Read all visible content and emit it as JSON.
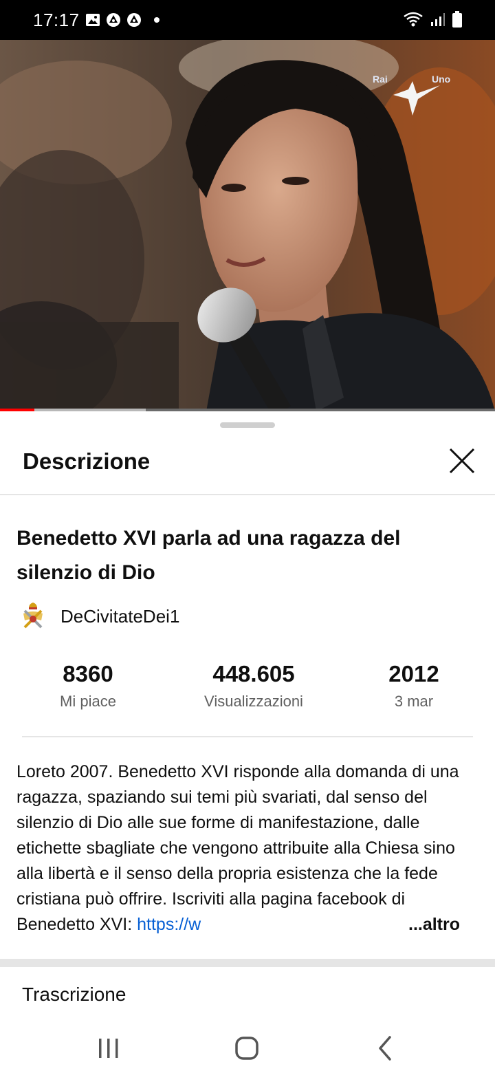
{
  "status_bar": {
    "time": "17:17",
    "icons_left": [
      "gallery-icon",
      "notification-icon",
      "notification-icon"
    ],
    "icons_right": [
      "wifi-icon",
      "signal-icon",
      "battery-icon"
    ]
  },
  "video": {
    "channel_logo_text_left": "Rai",
    "channel_logo_text_right": "Uno",
    "progress_played_fraction": 0.07,
    "progress_buffered_fraction": 0.295
  },
  "sheet": {
    "title": "Descrizione",
    "close_icon": "close-icon"
  },
  "video_info": {
    "title": "Benedetto XVI parla ad una ragazza del silenzio di Dio",
    "channel_name": "DeCivitateDei1"
  },
  "stats": {
    "likes_value": "8360",
    "likes_label": "Mi piace",
    "views_value": "448.605",
    "views_label": "Visualizzazioni",
    "year_value": "2012",
    "date_label": "3 mar"
  },
  "description": {
    "text": "Loreto 2007. Benedetto XVI risponde alla domanda di una ragazza, spaziando sui temi più svariati, dal senso del silenzio di Dio alle sue forme di manifestazione, dalle etichette sbagliate che vengono attribuite alla Chiesa sino alla libertà e il senso della propria esistenza che la fede cristiana può offrire. Iscriviti alla pagina facebook di Benedetto XVI: ",
    "link_text": "https://w",
    "more_label": "...altro"
  },
  "transcript": {
    "label": "Trascrizione"
  },
  "colors": {
    "progress_played": "#ff0000",
    "link": "#065fd4",
    "secondary_text": "#606060"
  }
}
